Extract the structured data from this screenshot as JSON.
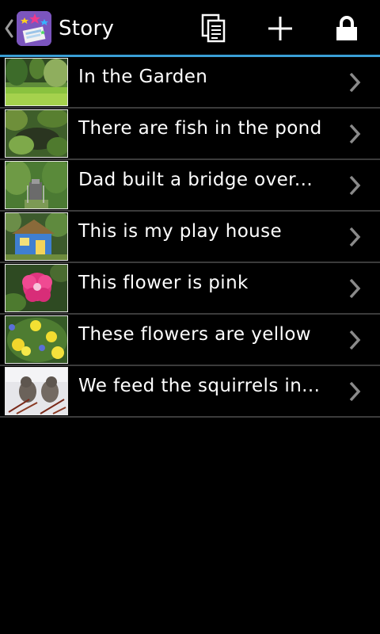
{
  "app": {
    "title": "Story"
  },
  "actions": [
    {
      "name": "pages-icon"
    },
    {
      "name": "add-icon"
    },
    {
      "name": "lock-icon"
    }
  ],
  "pages": [
    {
      "label": "In the Garden",
      "thumb": "garden-lawn"
    },
    {
      "label": "There are fish in the pond",
      "thumb": "pond"
    },
    {
      "label": "Dad built a bridge over...",
      "thumb": "bridge"
    },
    {
      "label": "This is my play house",
      "thumb": "play-house"
    },
    {
      "label": "This flower is pink",
      "thumb": "pink-flower"
    },
    {
      "label": "These flowers are yellow",
      "thumb": "yellow-flowers"
    },
    {
      "label": "We feed the squirrels in...",
      "thumb": "squirrels"
    }
  ],
  "colors": {
    "background": "#000000",
    "accent_line": "#3a9fd6",
    "divider": "#3b3b3b",
    "chevron": "#8a8a8a"
  }
}
